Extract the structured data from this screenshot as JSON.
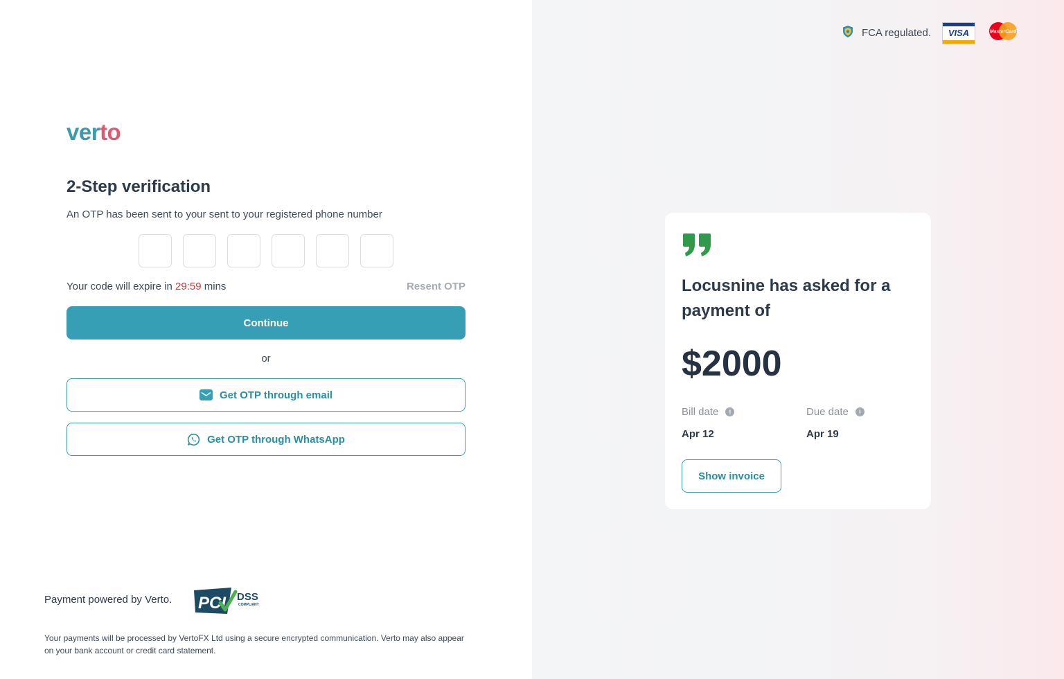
{
  "brand": {
    "logo_part1": "ver",
    "logo_part2": "to"
  },
  "verification": {
    "title": "2-Step verification",
    "subtitle": "An OTP has been sent to your sent to your registered phone number",
    "otp_digits": [
      "",
      "",
      "",
      "",
      "",
      ""
    ],
    "expire_prefix": "Your code will expire in ",
    "timer": "29:59",
    "expire_suffix": " mins",
    "resend_label": "Resent OTP",
    "continue_label": "Continue",
    "or_label": "or",
    "email_label": "Get OTP through email",
    "whatsapp_label": "Get OTP through WhatsApp"
  },
  "footer": {
    "powered": "Payment powered by Verto.",
    "pci_text": "PCI",
    "dss_text": "DSS",
    "compliant_text": "COMPLIANT",
    "note": "Your payments will be processed by VertoFX Ltd using a secure encrypted communication. Verto may also appear on your bank account or credit card statement."
  },
  "trust": {
    "fca_label": "FCA regulated.",
    "visa_label": "VISA",
    "mastercard_label": "MasterCard"
  },
  "payment_card": {
    "title": "Locusnine has asked for a payment of",
    "amount": "$2000",
    "bill_date_label": "Bill date",
    "bill_date_value": "Apr 12",
    "due_date_label": "Due date",
    "due_date_value": "Apr 19",
    "show_invoice_label": "Show invoice"
  },
  "colors": {
    "primary": "#369fb5",
    "logo_teal": "#3a9aae",
    "logo_pink": "#d75d73",
    "timer_red": "#d93636",
    "quote_green": "#2e9a4a"
  }
}
